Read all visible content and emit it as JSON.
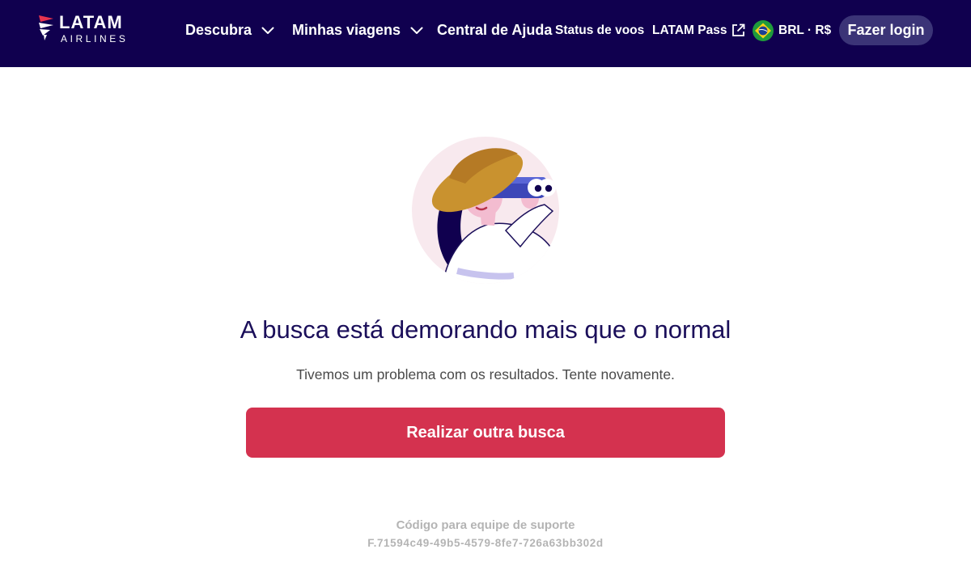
{
  "brand": {
    "name": "LATAM",
    "sub": "AIRLINES",
    "colors": {
      "navy": "#10004f",
      "red": "#d4324f",
      "login_bg": "#3b3477"
    }
  },
  "nav": {
    "discover": "Descubra",
    "my_trips": "Minhas viagens",
    "help_center": "Central de Ajuda",
    "flight_status": "Status de voos",
    "latam_pass": "LATAM Pass",
    "currency": "BRL · R$",
    "login": "Fazer login"
  },
  "icons": {
    "discover_chevron": "chevron-down-icon",
    "trips_chevron": "chevron-down-icon",
    "pass_external": "external-link-icon",
    "currency_flag": "brazil-flag-icon"
  },
  "error": {
    "illustration": "woman-with-binoculars",
    "title": "A busca está demorando mais que o normal",
    "message": "Tivemos um problema com os resultados. Tente novamente.",
    "button": "Realizar outra busca",
    "support_label": "Código para equipe de suporte",
    "support_code": "F.71594c49-49b5-4579-8fe7-726a63bb302d"
  }
}
